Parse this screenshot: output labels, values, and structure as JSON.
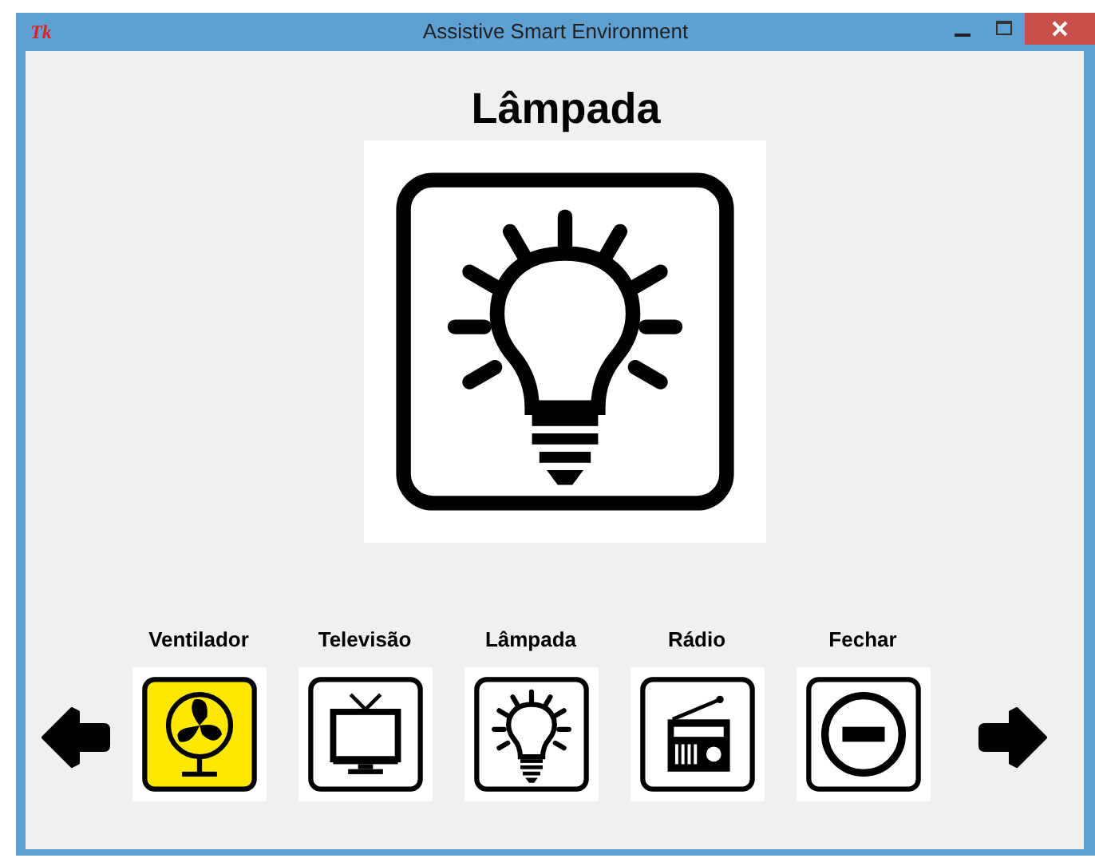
{
  "window": {
    "app_icon": "Tk",
    "title": "Assistive Smart Environment"
  },
  "main": {
    "title": "Lâmpada",
    "kind": "lamp"
  },
  "devices": [
    {
      "label": "Ventilador",
      "kind": "fan",
      "selected": true
    },
    {
      "label": "Televisão",
      "kind": "tv",
      "selected": false
    },
    {
      "label": "Lâmpada",
      "kind": "lamp",
      "selected": false
    },
    {
      "label": "Rádio",
      "kind": "radio",
      "selected": false
    },
    {
      "label": "Fechar",
      "kind": "close",
      "selected": false
    }
  ]
}
